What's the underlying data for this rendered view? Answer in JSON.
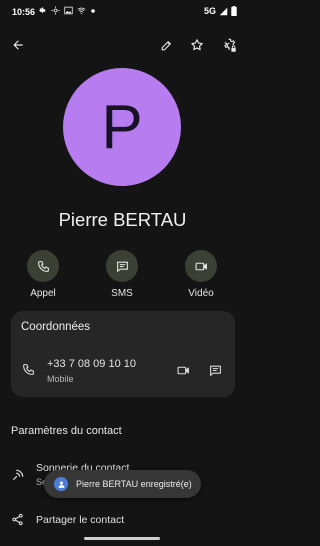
{
  "status_bar": {
    "time": "10:56",
    "network": "5G",
    "icons": [
      "settings-gear-icon",
      "sun-icon",
      "photo-icon",
      "wifi-calling-icon",
      "dot-icon",
      "signal-icon",
      "battery-icon"
    ]
  },
  "top_bar": {
    "icons": [
      "back-arrow-icon",
      "edit-pencil-icon",
      "star-icon",
      "settings-lock-icon"
    ]
  },
  "contact": {
    "initial": "P",
    "name": "Pierre BERTAU",
    "avatar_color": "#b77cf0"
  },
  "actions": [
    {
      "label": "Appel",
      "icon": "phone-icon"
    },
    {
      "label": "SMS",
      "icon": "message-icon"
    },
    {
      "label": "Vidéo",
      "icon": "video-icon"
    }
  ],
  "details_card": {
    "title": "Coordonnées",
    "phone": "+33 7 08 09 10 10",
    "phone_type": "Mobile"
  },
  "settings": {
    "title": "Paramètres du contact",
    "ringtone_label": "Sonnerie du contact",
    "ringtone_sub": "Se",
    "share_label": "Partager le contact"
  },
  "snackbar": {
    "text": "Pierre BERTAU enregistré(e)"
  },
  "colors": {
    "background": "#141414",
    "action_circle": "#3a4033",
    "card": "#262626",
    "snackbar": "#363636"
  }
}
